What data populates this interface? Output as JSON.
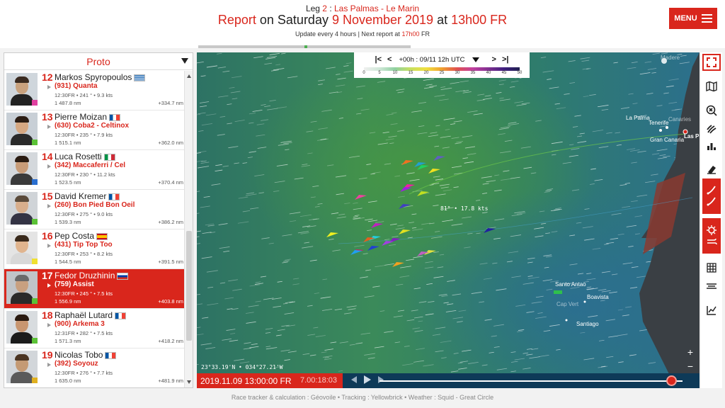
{
  "header": {
    "leg_prefix": "Leg ",
    "leg_number": "2",
    "leg_sep": " : ",
    "leg_route": "Las Palmas - Le Marin",
    "report_word": "Report",
    "report_on": " on Saturday ",
    "report_date": "9 November 2019",
    "report_at": " at ",
    "report_time": "13h00 FR",
    "update_text": "Update every 4 hours | Next report at ",
    "next_time": "17h00",
    "next_zone": " FR",
    "menu_label": "MENU"
  },
  "panel": {
    "category": "Proto"
  },
  "skippers": [
    {
      "rank": "12",
      "name": "Markos Spyropoulos",
      "flag": "gr",
      "boat": "(931) Quanta",
      "stats": "12:30FR • 241 ° • 9.3 kts",
      "dist": "1 487.8 nm",
      "gap": "+334.7 nm",
      "corner": "#e040a0",
      "selected": false,
      "skin": "#c9a27e",
      "hair": "#3a2a20",
      "shirt": "#222",
      "bgcol": "#cfd6dc"
    },
    {
      "rank": "13",
      "name": "Pierre Moizan",
      "flag": "fr",
      "boat": "(630) Coba2 - Celtinox",
      "stats": "12:30FR • 235 ° • 7.9 kts",
      "dist": "1 515.1 nm",
      "gap": "+362.0 nm",
      "corner": "#5bc236",
      "selected": false,
      "skin": "#d6a882",
      "hair": "#2b1d14",
      "shirt": "#2a2a2a",
      "bgcol": "#c8cfd6"
    },
    {
      "rank": "14",
      "name": "Luca Rosetti",
      "flag": "it",
      "boat": "(342) Maccaferri / Cel",
      "stats": "12:30FR • 230 ° • 11.2 kts",
      "dist": "1 523.5 nm",
      "gap": "+370.4 nm",
      "corner": "#2a6fd0",
      "selected": false,
      "skin": "#c89c78",
      "hair": "#2a1c12",
      "shirt": "#3a3a3a",
      "bgcol": "#d4d8dc"
    },
    {
      "rank": "15",
      "name": "David Kremer",
      "flag": "fr",
      "boat": "(260) Bon Pied Bon Oeil",
      "stats": "12:30FR • 275 ° • 9.0 kts",
      "dist": "1 539.3 nm",
      "gap": "+386.2 nm",
      "corner": "#5bc236",
      "selected": false,
      "skin": "#d8ae8c",
      "hair": "#5a4a3a",
      "shirt": "#334",
      "bgcol": "#d0d4d8"
    },
    {
      "rank": "16",
      "name": "Pep Costa",
      "flag": "es",
      "boat": "(431) Tip Top Too",
      "stats": "12:30FR • 253 ° • 8.2 kts",
      "dist": "1 544.5 nm",
      "gap": "+391.5 nm",
      "corner": "#f0e030",
      "selected": false,
      "skin": "#e0b48e",
      "hair": "#3a2a1c",
      "shirt": "#d8d8d8",
      "bgcol": "#e4e4e4"
    },
    {
      "rank": "17",
      "name": "Fedor Druzhinin",
      "flag": "ru",
      "boat": "(759) Assist",
      "stats": "12:30FR • 245 ° • 7.5 kts",
      "dist": "1 556.9 nm",
      "gap": "+403.8 nm",
      "corner": "#5bc236",
      "selected": true,
      "skin": "#c8a080",
      "hair": "#6a6a6a",
      "shirt": "#2a2a2a",
      "bgcol": "#c0c4c8"
    },
    {
      "rank": "18",
      "name": "Raphaël Lutard",
      "flag": "fr",
      "boat": "(900) Arkema 3",
      "stats": "12:31FR • 282 ° • 7.5 kts",
      "dist": "1 571.3 nm",
      "gap": "+418.2 nm",
      "corner": "#5bc236",
      "selected": false,
      "skin": "#c89670",
      "hair": "#2a1a10",
      "shirt": "#1c1c1c",
      "bgcol": "#d8dcdf"
    },
    {
      "rank": "19",
      "name": "Nicolas Tobo",
      "flag": "fr",
      "boat": "(392) Soyouz",
      "stats": "12:30FR • 276 ° • 7.7 kts",
      "dist": "1 635.0 nm",
      "gap": "+481.9 nm",
      "corner": "#e0b020",
      "selected": false,
      "skin": "#c49a74",
      "hair": "#4a3422",
      "shirt": "#5a5a5a",
      "bgcol": "#d2d6da"
    }
  ],
  "map": {
    "time_label": "+00h : 09/11 12h UTC",
    "scale_ticks": [
      "0",
      "5",
      "10",
      "15",
      "20",
      "25",
      "30",
      "35",
      "40",
      "45",
      "50"
    ],
    "coords": "23°33.19'N • 034°27.21'W",
    "speed_label": "81° • 17.8 kts",
    "places": [
      {
        "name": "La Palma"
      },
      {
        "name": "Tenerife"
      },
      {
        "name": "Canaries"
      },
      {
        "name": "Gran Canaria"
      },
      {
        "name": "Las P"
      },
      {
        "name": "Santo Antao"
      },
      {
        "name": "Boavista"
      },
      {
        "name": "Cap Vert"
      },
      {
        "name": "Santiago"
      },
      {
        "name": "Madere"
      }
    ],
    "date": "2019.11.09 13:00:00 FR",
    "elapsed": "7.00:18:03",
    "progress": 0.96
  },
  "footer": {
    "text": "Race tracker & calculation : Géovoile • Tracking : Yellowbrick • Weather : Squid - Great Circle"
  },
  "colors": {
    "accent": "#d9261c",
    "ocean": "#2f7a6e",
    "timeline": "#0e3a58"
  }
}
